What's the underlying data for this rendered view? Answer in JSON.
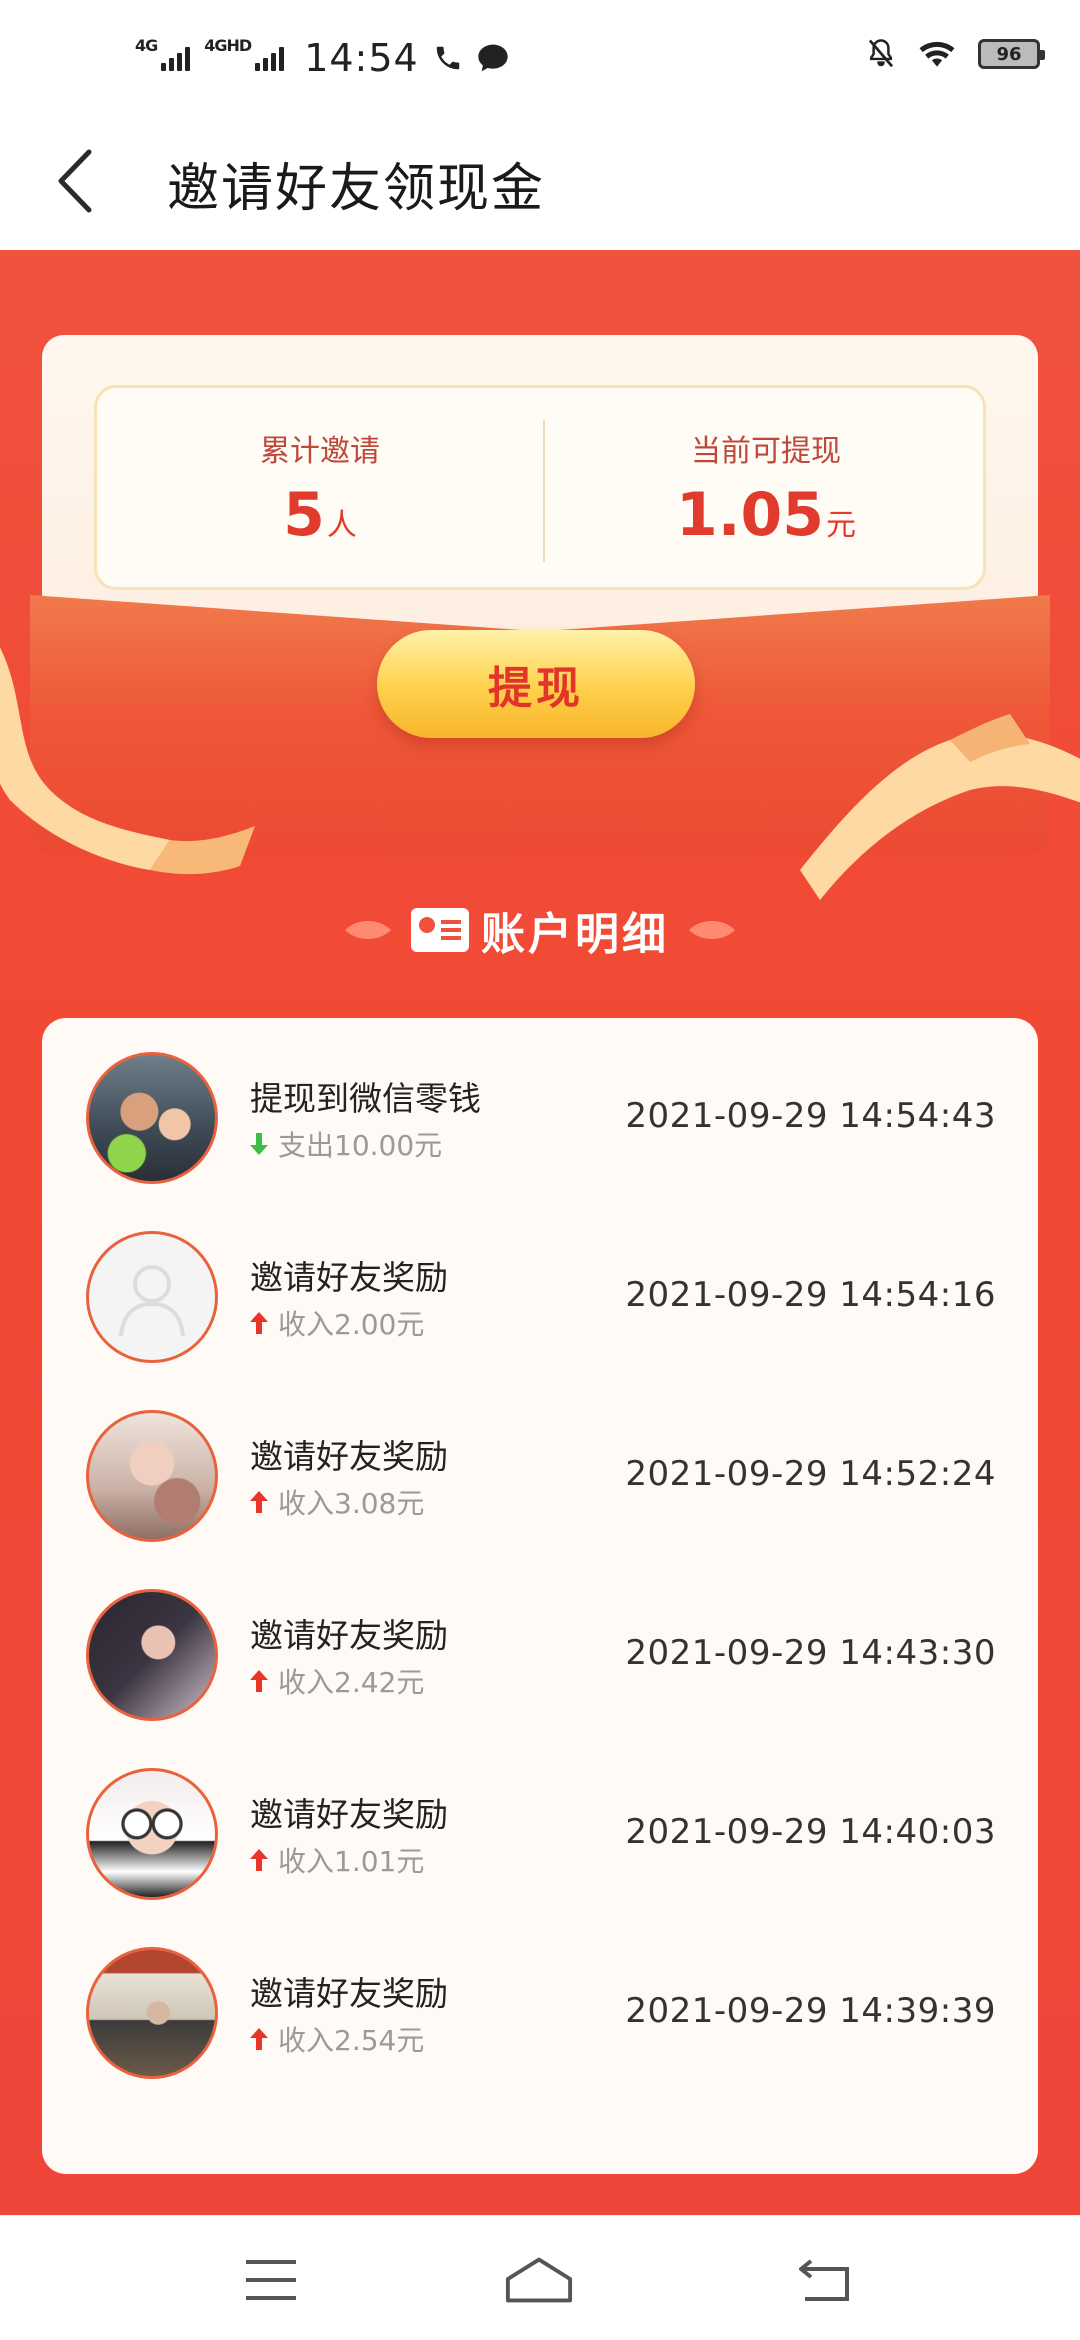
{
  "status_bar": {
    "network1": "4G",
    "network2": "4GHD",
    "time": "14:54",
    "battery": "96"
  },
  "header": {
    "title": "邀请好友领现金"
  },
  "stats": {
    "invited_label": "累计邀请",
    "invited_value": "5",
    "invited_unit": "人",
    "withdrawable_label": "当前可提现",
    "withdrawable_value": "1.05",
    "withdrawable_unit": "元"
  },
  "withdraw_button": "提现",
  "section_title": "账户明细",
  "records": [
    {
      "title": "提现到微信零钱",
      "direction": "out",
      "amount": "支出10.00元",
      "time": "2021-09-29 14:54:43"
    },
    {
      "title": "邀请好友奖励",
      "direction": "in",
      "amount": "收入2.00元",
      "time": "2021-09-29 14:54:16"
    },
    {
      "title": "邀请好友奖励",
      "direction": "in",
      "amount": "收入3.08元",
      "time": "2021-09-29 14:52:24"
    },
    {
      "title": "邀请好友奖励",
      "direction": "in",
      "amount": "收入2.42元",
      "time": "2021-09-29 14:43:30"
    },
    {
      "title": "邀请好友奖励",
      "direction": "in",
      "amount": "收入1.01元",
      "time": "2021-09-29 14:40:03"
    },
    {
      "title": "邀请好友奖励",
      "direction": "in",
      "amount": "收入2.54元",
      "time": "2021-09-29 14:39:39"
    }
  ],
  "colors": {
    "primary_red": "#f0503c",
    "value_red": "#e13b2d",
    "income_arrow": "#e8352a",
    "expense_arrow": "#3cbf4a",
    "button_gold": "#ffd04a"
  },
  "icons": {
    "back": "chevron-left-icon",
    "menu": "menu-icon",
    "home": "home-icon",
    "return": "return-icon"
  }
}
